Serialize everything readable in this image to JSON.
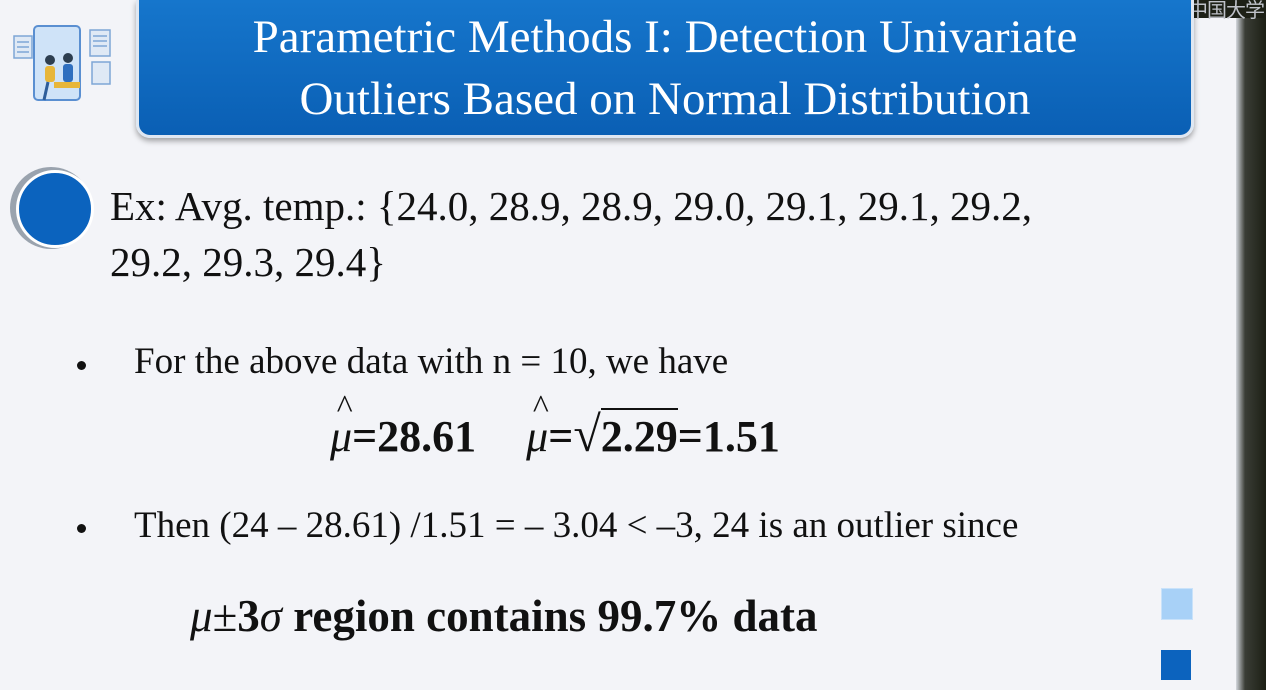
{
  "watermark": "中国大学",
  "title": {
    "line1": "Parametric Methods I: Detection Univariate",
    "line2": "Outliers Based on Normal Distribution"
  },
  "example": {
    "line1": "Ex: Avg. temp.: {24.0, 28.9, 28.9, 29.0, 29.1, 29.1, 29.2,",
    "line2": "29.2, 29.3, 29.4}"
  },
  "bullets": {
    "first": "For the above data with n = 10, we have",
    "second": "Then (24 – 28.61) /1.51 = – 3.04 < –3, 24 is an outlier since"
  },
  "formula": {
    "mu_symbol": "μ",
    "hat": "^",
    "mean_value": "=28.61",
    "equals": "=",
    "sqrt_symbol": "√",
    "variance": "2.29",
    "std_value": "=1.51"
  },
  "region": {
    "mu": "μ",
    "pm": "±",
    "three": "3",
    "sigma": "σ",
    "text": " region contains 99.7% data"
  },
  "colors": {
    "title_bg": "#0a5fb4",
    "bullet_circle": "#0b63be",
    "square_light": "#a8d1f7",
    "square_dark": "#0c63be"
  }
}
